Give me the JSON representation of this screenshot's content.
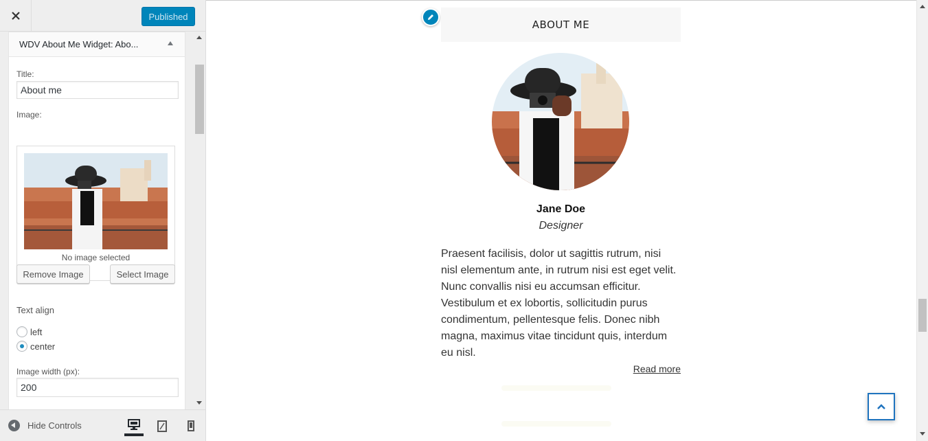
{
  "header": {
    "close_icon": "close-icon",
    "publish_label": "Published"
  },
  "widget": {
    "title": "WDV About Me Widget: Abo...",
    "fields": {
      "title_label": "Title:",
      "title_value": "About me",
      "image_label": "Image:",
      "no_image_text": "No image selected",
      "remove_image_label": "Remove Image",
      "select_image_label": "Select Image",
      "text_align_label": "Text align",
      "align_options": [
        {
          "label": "left",
          "checked": false
        },
        {
          "label": "center",
          "checked": true
        }
      ],
      "image_width_label": "Image width (px):",
      "image_width_value": "200"
    }
  },
  "footer": {
    "hide_controls_label": "Hide Controls",
    "devices": [
      {
        "name": "desktop-icon",
        "active": true
      },
      {
        "name": "tablet-icon",
        "active": false
      },
      {
        "name": "mobile-icon",
        "active": false
      }
    ]
  },
  "preview": {
    "widget_title": "ABOUT ME",
    "name": "Jane Doe",
    "role": "Designer",
    "bio_lines": [
      "Praesent facilisis, dolor ut sagittis rutrum, nisi",
      "nisl elementum ante, in rutrum nisi est eget velit.",
      "Nunc convallis nisi eu accumsan efficitur.",
      "Vestibulum et ex lobortis, sollicitudin purus",
      "condimentum, pellentesque felis. Donec nibh",
      "magna, maximus vitae tincidunt quis, interdum",
      "eu nisl."
    ],
    "read_more": "Read more"
  },
  "colors": {
    "accent": "#0085ba",
    "scroll_top_border": "#1e73be"
  }
}
